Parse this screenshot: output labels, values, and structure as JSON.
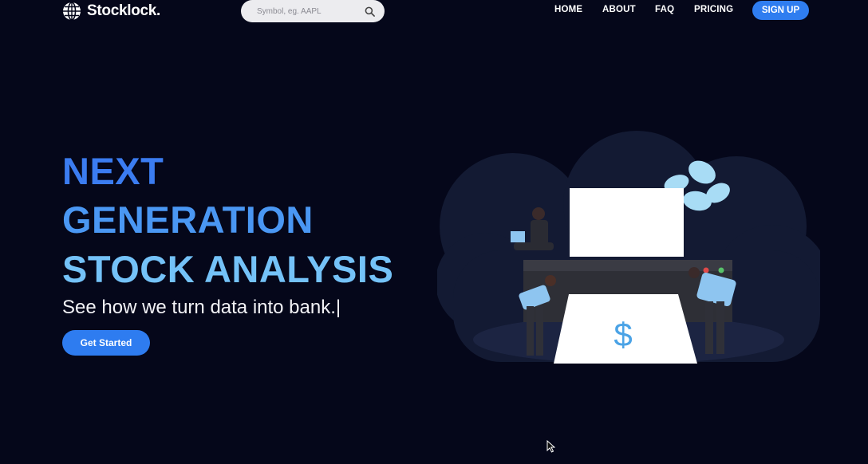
{
  "brand": {
    "name": "Stocklock."
  },
  "search": {
    "placeholder": "Symbol, eg. AAPL"
  },
  "nav": {
    "home": "HOME",
    "about": "ABOUT",
    "faq": "FAQ",
    "pricing": "PRICING",
    "signup": "SIGN UP"
  },
  "hero": {
    "line1": "NEXT",
    "line2": "GENERATION",
    "line3": "STOCK ANALYSIS",
    "subtitle": "See how we turn data into bank.|",
    "cta": "Get Started"
  },
  "illustration": {
    "symbol": "$"
  },
  "colors": {
    "background": "#05071a",
    "accent": "#2f7df0",
    "gradient_top": "#3b7cf1",
    "gradient_bottom": "#74c2f8"
  },
  "icons": [
    "globe-icon",
    "search-icon",
    "mouse-cursor-icon"
  ]
}
